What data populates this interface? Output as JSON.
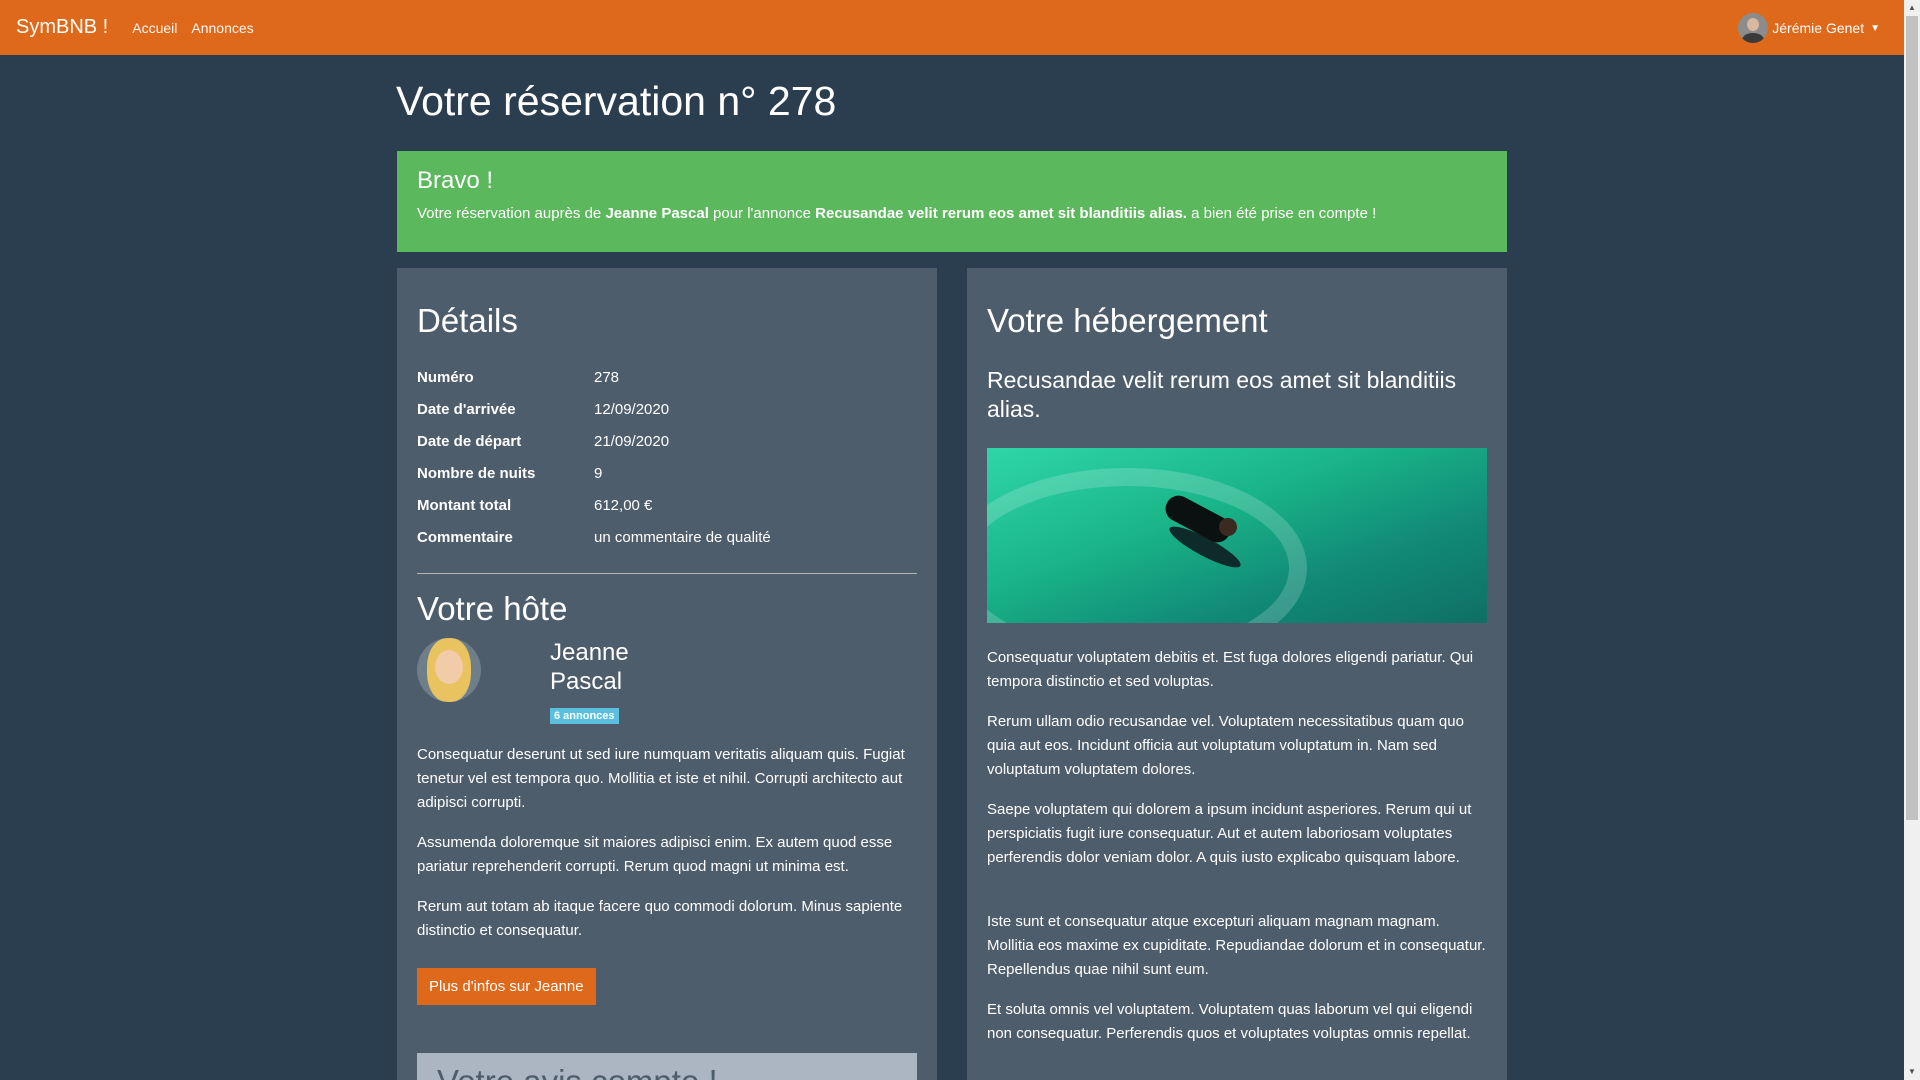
{
  "navbar": {
    "brand": "SymBNB !",
    "links": [
      "Accueil",
      "Annonces"
    ],
    "user_name": "Jérémie Genet"
  },
  "page": {
    "title": "Votre réservation n° 278"
  },
  "alert": {
    "heading": "Bravo !",
    "text_1": "Votre réservation auprès de ",
    "host": "Jeanne Pascal",
    "text_2": " pour l'annonce ",
    "ad_title": "Recusandae velit rerum eos amet sit blanditiis alias.",
    "text_3": " a bien été prise en compte !"
  },
  "details": {
    "title": "Détails",
    "rows": [
      {
        "label": "Numéro",
        "value": "278"
      },
      {
        "label": "Date d'arrivée",
        "value": "12/09/2020"
      },
      {
        "label": "Date de départ",
        "value": "21/09/2020"
      },
      {
        "label": "Nombre de nuits",
        "value": "9"
      },
      {
        "label": "Montant total",
        "value": "612,00 €"
      },
      {
        "label": "Commentaire",
        "value": "un commentaire de qualité"
      }
    ]
  },
  "host": {
    "title": "Votre hôte",
    "first_name": "Jeanne",
    "last_name": "Pascal",
    "badge": "6 annonces",
    "paragraphs": [
      "Consequatur deserunt ut sed iure numquam veritatis aliquam quis. Fugiat tenetur vel est tempora quo. Mollitia et iste et nihil. Corrupti architecto aut adipisci corrupti.",
      "Assumenda doloremque sit maiores adipisci enim. Ex autem quod esse pariatur reprehenderit corrupti. Rerum quod magni ut minima est.",
      "Rerum aut totam ab itaque facere quo commodi dolorum. Minus sapiente distinctio et consequatur."
    ],
    "button": "Plus d'infos sur Jeanne"
  },
  "next_section_title": "Votre avis compte !",
  "lodging": {
    "title": "Votre hébergement",
    "ad_title": "Recusandae velit rerum eos amet sit blanditiis alias.",
    "paragraphs": [
      "Consequatur voluptatem debitis et. Est fuga dolores eligendi pariatur. Qui tempora distinctio et sed voluptas.",
      "Rerum ullam odio recusandae vel. Voluptatem necessitatibus quam quo quia aut eos. Incidunt officia aut voluptatum voluptatum in. Nam sed voluptatum voluptatem dolores.",
      "Saepe voluptatem qui dolorem a ipsum incidunt asperiores. Rerum qui ut perspiciatis fugit iure consequatur. Aut et autem laboriosam voluptates perferendis dolor veniam dolor. A quis iusto explicabo quisquam labore.",
      "Iste sunt et consequatur atque excepturi aliquam magnam magnam. Mollitia eos maxime ex cupiditate. Repudiandae dolorum et in consequatur. Repellendus quae nihil sunt eum.",
      "Et soluta omnis vel voluptatem. Voluptatem quas laborum vel qui eligendi non consequatur. Perferendis quos et voluptates voluptas omnis repellat."
    ]
  },
  "colors": {
    "navbar": "#df691a",
    "background": "#2b3e50",
    "card": "#4e5d6c",
    "success": "#5cb85c",
    "badge": "#5bc0de"
  }
}
